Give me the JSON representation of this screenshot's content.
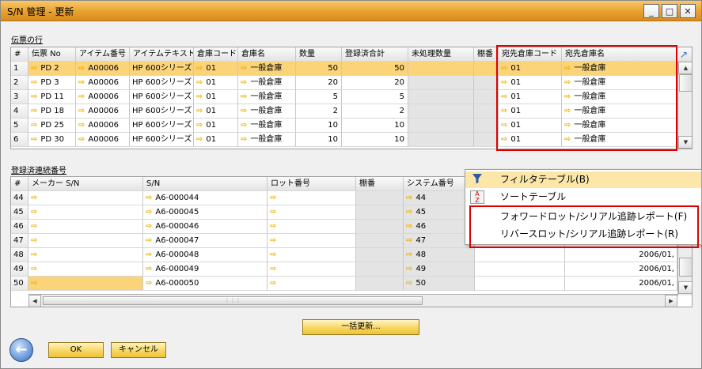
{
  "window": {
    "title": "S/N 管理 - 更新",
    "minimize": "_",
    "maximize": "□",
    "close": "✕"
  },
  "top": {
    "label": "伝票の行",
    "corner": "#",
    "headers": [
      "伝票 No",
      "アイテム番号",
      "アイテムテキスト",
      "倉庫コード",
      "倉庫名",
      "数量",
      "登録済合計",
      "未処理数量",
      "棚番",
      "宛先倉庫コード",
      "宛先倉庫名"
    ],
    "rows": [
      {
        "n": "1",
        "doc": "PD 2",
        "item": "A00006",
        "text": "HP 600シリーズ",
        "wh": "01",
        "whname": "一般倉庫",
        "qty": "50",
        "reg": "50",
        "open": "",
        "bin": "",
        "dwh": "01",
        "dwhname": "一般倉庫"
      },
      {
        "n": "2",
        "doc": "PD 3",
        "item": "A00006",
        "text": "HP 600シリーズ",
        "wh": "01",
        "whname": "一般倉庫",
        "qty": "20",
        "reg": "20",
        "open": "",
        "bin": "",
        "dwh": "01",
        "dwhname": "一般倉庫"
      },
      {
        "n": "3",
        "doc": "PD 11",
        "item": "A00006",
        "text": "HP 600シリーズ",
        "wh": "01",
        "whname": "一般倉庫",
        "qty": "5",
        "reg": "5",
        "open": "",
        "bin": "",
        "dwh": "01",
        "dwhname": "一般倉庫"
      },
      {
        "n": "4",
        "doc": "PD 18",
        "item": "A00006",
        "text": "HP 600シリーズ",
        "wh": "01",
        "whname": "一般倉庫",
        "qty": "2",
        "reg": "2",
        "open": "",
        "bin": "",
        "dwh": "01",
        "dwhname": "一般倉庫"
      },
      {
        "n": "5",
        "doc": "PD 25",
        "item": "A00006",
        "text": "HP 600シリーズ",
        "wh": "01",
        "whname": "一般倉庫",
        "qty": "10",
        "reg": "10",
        "open": "",
        "bin": "",
        "dwh": "01",
        "dwhname": "一般倉庫"
      },
      {
        "n": "6",
        "doc": "PD 30",
        "item": "A00006",
        "text": "HP 600シリーズ",
        "wh": "01",
        "whname": "一般倉庫",
        "qty": "10",
        "reg": "10",
        "open": "",
        "bin": "",
        "dwh": "01",
        "dwhname": "一般倉庫"
      }
    ]
  },
  "bottom": {
    "label": "登録済連続番号",
    "corner": "#",
    "headers": [
      "メーカー S/N",
      "S/N",
      "ロット番号",
      "棚番",
      "システム番号"
    ],
    "rows": [
      {
        "n": "44",
        "sn": "A6-000044",
        "sys": "44",
        "date": ""
      },
      {
        "n": "45",
        "sn": "A6-000045",
        "sys": "45",
        "date": ""
      },
      {
        "n": "46",
        "sn": "A6-000046",
        "sys": "46",
        "date": ""
      },
      {
        "n": "47",
        "sn": "A6-000047",
        "sys": "47",
        "date": ""
      },
      {
        "n": "48",
        "sn": "A6-000048",
        "sys": "48",
        "date": "2006/01,"
      },
      {
        "n": "49",
        "sn": "A6-000049",
        "sys": "49",
        "date": "2006/01,"
      },
      {
        "n": "50",
        "sn": "A6-000050",
        "sys": "50",
        "date": "2006/01,"
      }
    ]
  },
  "context_menu": {
    "items": [
      {
        "label": "フィルタテーブル(B)",
        "icon": "funnel-icon"
      },
      {
        "label": "ソートテーブル",
        "icon": "sort-az-icon"
      },
      {
        "label": "フォワードロット/シリアル追跡レポート(F)",
        "icon": ""
      },
      {
        "label": "リバースロット/シリアル追跡レポート(R)",
        "icon": ""
      }
    ]
  },
  "buttons": {
    "bulk_update": "一括更新...",
    "ok": "OK",
    "cancel": "キャンセル"
  },
  "colors": {
    "titlebar": "#e8a030",
    "selected_row": "#fbd47a",
    "highlight": "#e00000",
    "arrow": "#e8b000"
  }
}
